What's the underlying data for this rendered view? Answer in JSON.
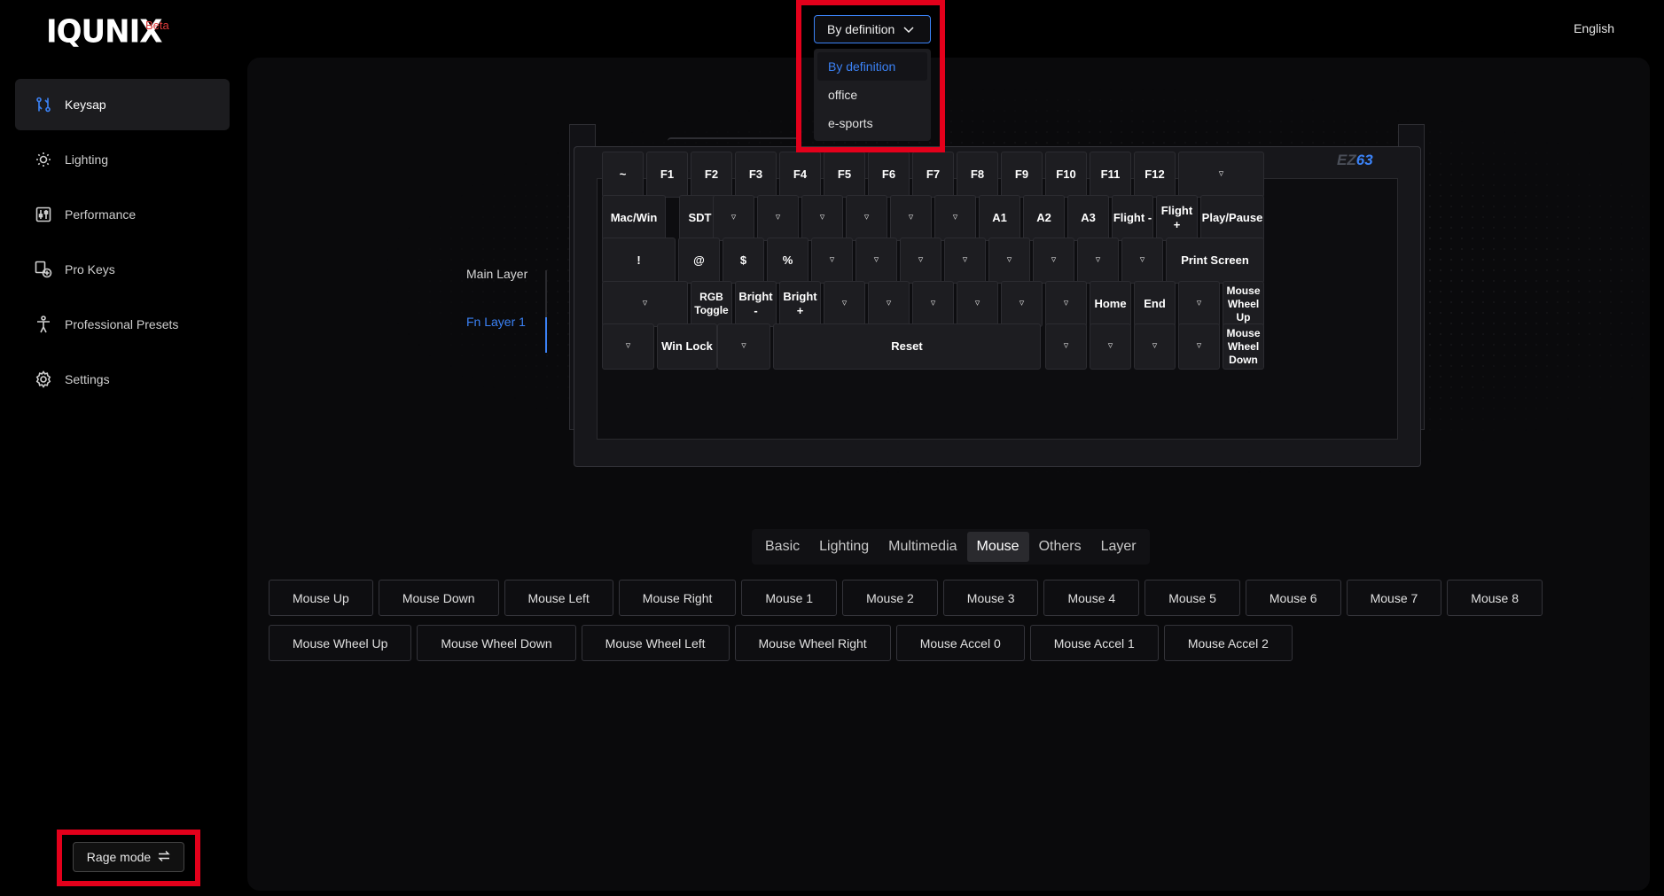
{
  "header": {
    "brand": "IQUNIX",
    "beta": "Beta",
    "language": "English"
  },
  "sidebar": {
    "items": [
      {
        "label": "Keysap",
        "icon": "keymap-icon",
        "active": true
      },
      {
        "label": "Lighting",
        "icon": "sun-icon",
        "active": false
      },
      {
        "label": "Performance",
        "icon": "sliders-icon",
        "active": false
      },
      {
        "label": "Pro Keys",
        "icon": "pro-keys-icon",
        "active": false
      },
      {
        "label": "Professional Presets",
        "icon": "person-icon",
        "active": false
      },
      {
        "label": "Settings",
        "icon": "gear-icon",
        "active": false
      }
    ]
  },
  "rage_mode": {
    "label": "Rage mode",
    "icon": "swap-icon"
  },
  "preset_dropdown": {
    "selected": "By definition",
    "options": [
      "By definition",
      "office",
      "e-sports"
    ]
  },
  "layers": {
    "main": "Main Layer",
    "fn1": "Fn Layer 1",
    "active": "Fn Layer 1"
  },
  "keyboard": {
    "model_prefix": "EZ",
    "model_number": "63",
    "rows": [
      [
        "~",
        "F1",
        "F2",
        "F3",
        "F4",
        "F5",
        "F6",
        "F7",
        "F8",
        "F9",
        "F10",
        "F11",
        "F12",
        "▿"
      ],
      [
        "Mac/Win",
        "SDT",
        "▿",
        "▿",
        "▿",
        "▿",
        "▿",
        "▿",
        "A1",
        "A2",
        "A3",
        "Flight -",
        "Flight +",
        "Play/Pause"
      ],
      [
        "!",
        "@",
        "$",
        "%",
        "▿",
        "▿",
        "▿",
        "▿",
        "▿",
        "▿",
        "▿",
        "▿",
        "Print Screen"
      ],
      [
        "▿",
        "RGB Toggle",
        "Bright -",
        "Bright +",
        "▿",
        "▿",
        "▿",
        "▿",
        "▿",
        "▿",
        "Home",
        "End",
        "▿",
        "Mouse Wheel Up"
      ],
      [
        "▿",
        "Win Lock",
        "▿",
        "Reset",
        "▿",
        "▿",
        "▿",
        "▿",
        "Mouse Wheel Down"
      ]
    ]
  },
  "tabs": {
    "items": [
      "Basic",
      "Lighting",
      "Multimedia",
      "Mouse",
      "Others",
      "Layer"
    ],
    "active": "Mouse"
  },
  "mouse_buttons": {
    "row1": [
      "Mouse Up",
      "Mouse Down",
      "Mouse Left",
      "Mouse Right",
      "Mouse 1",
      "Mouse 2",
      "Mouse 3",
      "Mouse 4",
      "Mouse 5",
      "Mouse 6",
      "Mouse 7",
      "Mouse 8"
    ],
    "row2": [
      "Mouse Wheel Up",
      "Mouse Wheel Down",
      "Mouse Wheel Left",
      "Mouse Wheel Right",
      "Mouse Accel 0",
      "Mouse Accel 1",
      "Mouse Accel 2"
    ]
  },
  "colors": {
    "accent": "#3b82f6",
    "highlight_box": "#e3001b",
    "beta": "#e03c3c"
  }
}
